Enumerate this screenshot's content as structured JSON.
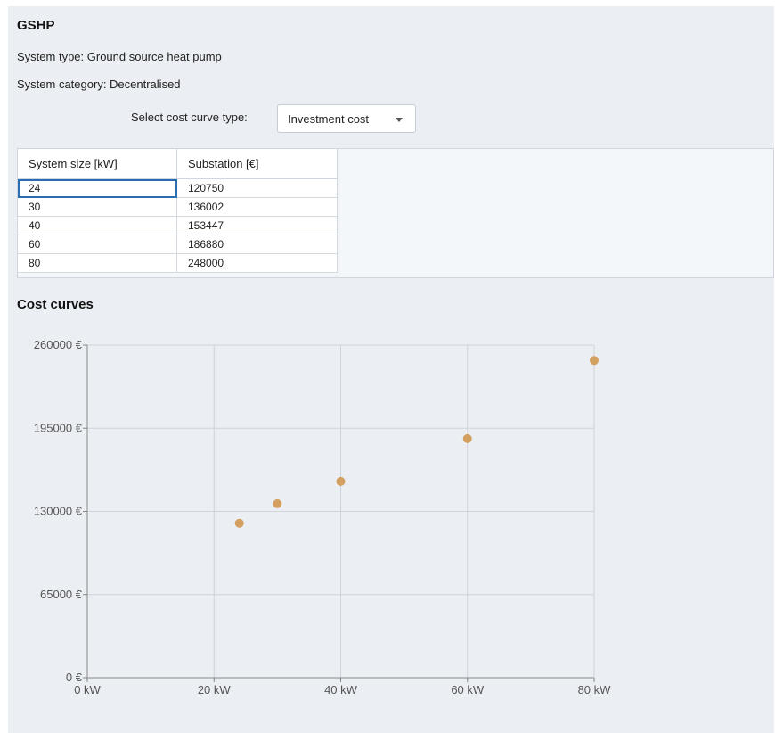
{
  "header": {
    "title": "GSHP",
    "system_type": "System type: Ground source heat pump",
    "system_category": "System category: Decentralised"
  },
  "cost_curve": {
    "select_label": "Select cost curve type:",
    "selected": "Investment cost"
  },
  "table": {
    "columns": [
      "System size [kW]",
      "Substation [€]"
    ],
    "rows": [
      [
        "24",
        "120750"
      ],
      [
        "30",
        "136002"
      ],
      [
        "40",
        "153447"
      ],
      [
        "60",
        "186880"
      ],
      [
        "80",
        "248000"
      ]
    ]
  },
  "section_title": "Cost curves",
  "chart_data": {
    "type": "scatter",
    "x": [
      24,
      30,
      40,
      60,
      80
    ],
    "y": [
      120750,
      136002,
      153447,
      186880,
      248000
    ],
    "xlim": [
      0,
      80
    ],
    "ylim": [
      0,
      260000
    ],
    "xticks": [
      0,
      20,
      40,
      60,
      80
    ],
    "yticks": [
      0,
      65000,
      130000,
      195000,
      260000
    ],
    "xtick_labels": [
      "0 kW",
      "20 kW",
      "40 kW",
      "60 kW",
      "80 kW"
    ],
    "ytick_labels": [
      "0 €",
      "65000 €",
      "130000 €",
      "195000 €",
      "260000 €"
    ],
    "grid": true,
    "point_color": "#d4a060"
  }
}
